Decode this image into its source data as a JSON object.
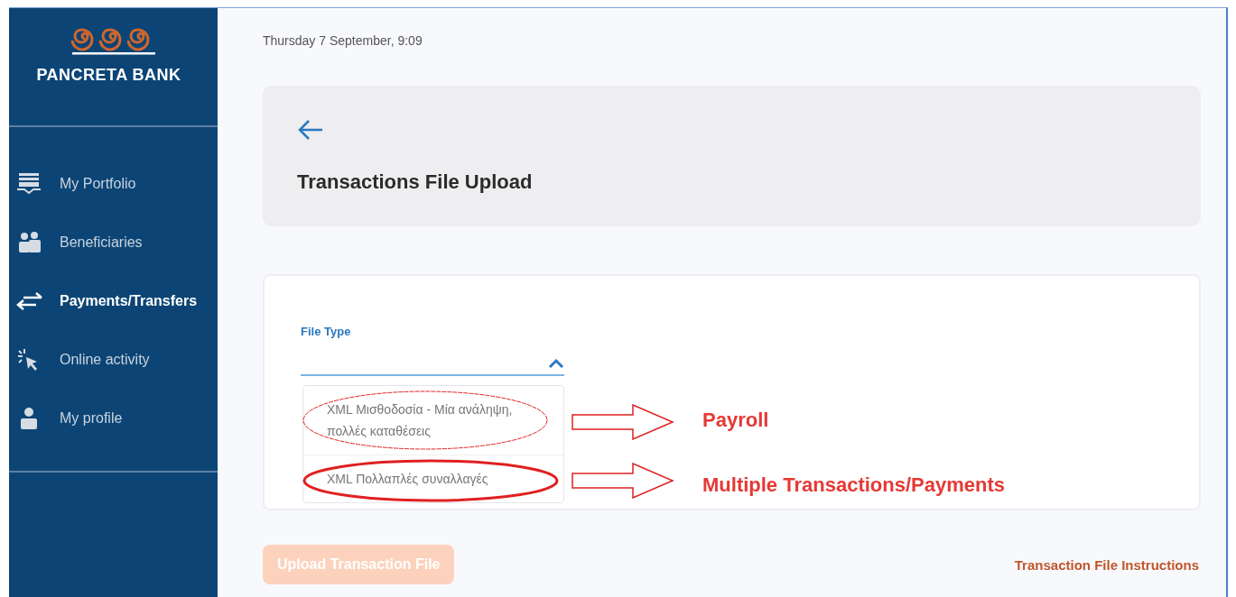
{
  "brand": {
    "name": "PANCRETA BANK"
  },
  "sidebar": {
    "items": [
      {
        "label": "My Portfolio",
        "selected": false
      },
      {
        "label": "Beneficiaries",
        "selected": false
      },
      {
        "label": "Payments/Transfers",
        "selected": true
      },
      {
        "label": "Online activity",
        "selected": false
      },
      {
        "label": "My profile",
        "selected": false
      }
    ]
  },
  "date": "Thursday 7 September, 9:09",
  "page_title": "Transactions File Upload",
  "file_type": {
    "label": "File Type",
    "expanded": true,
    "options": [
      {
        "label": "XML Μισθοδοσία - Μία ανάληψη, πολλές καταθέσεις",
        "annotation": "Payroll"
      },
      {
        "label": "XML Πολλαπλές συναλλαγές",
        "annotation": "Multiple Transactions/Payments"
      }
    ]
  },
  "upload_button": {
    "label": "Upload Transaction File",
    "disabled": true
  },
  "instructions_link": "Transaction File Instructions"
}
